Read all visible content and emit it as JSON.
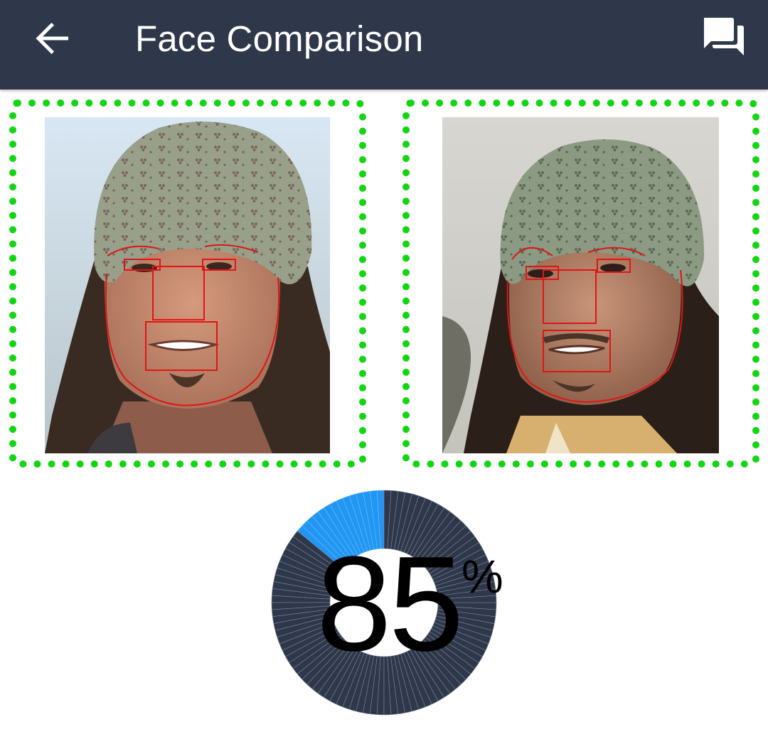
{
  "header": {
    "title": "Face Comparison",
    "back_icon": "arrow-back-icon",
    "feedback_icon": "feedback-icon",
    "background_color": "#2f384b"
  },
  "faces": [
    {
      "label": "face-1",
      "border_color": "#11d611",
      "overlay_color": "#e01515"
    },
    {
      "label": "face-2",
      "border_color": "#11d611",
      "overlay_color": "#e01515"
    }
  ],
  "result": {
    "score": "85",
    "unit": "%",
    "fraction": 0.14,
    "fill_color": "#2196f3",
    "track_color": "#2f384b"
  }
}
